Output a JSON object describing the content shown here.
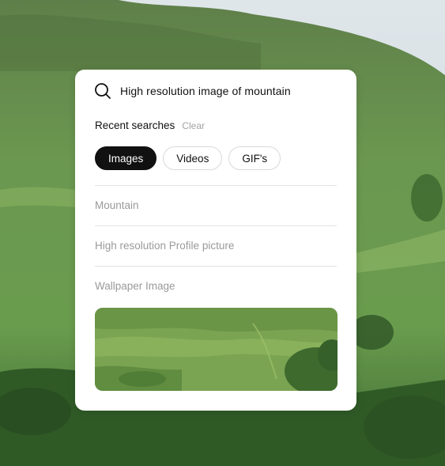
{
  "search": {
    "query": "High resolution image of mountain"
  },
  "recent": {
    "title": "Recent searches",
    "clear_label": "Clear"
  },
  "filters": [
    {
      "label": "Images",
      "active": true
    },
    {
      "label": "Videos",
      "active": false
    },
    {
      "label": "GIF's",
      "active": false
    }
  ],
  "recent_items": [
    {
      "label": "Mountain"
    },
    {
      "label": "High resolution Profile picture"
    },
    {
      "label": "Wallpaper Image"
    }
  ],
  "icons": {
    "search": "search-icon"
  },
  "colors": {
    "active_chip": "#111111",
    "muted_text": "#9a9a9a",
    "card": "#ffffff"
  }
}
